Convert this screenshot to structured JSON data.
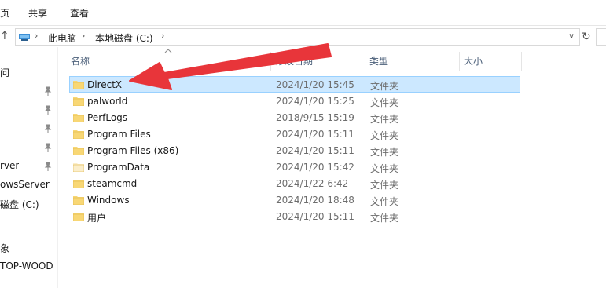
{
  "ribbon": {
    "tabs": [
      "页",
      "共享",
      "查看"
    ]
  },
  "address": {
    "crumbs": [
      "此电脑",
      "本地磁盘 (C:)"
    ],
    "separator": "›"
  },
  "nav": {
    "items": [
      {
        "label": "问",
        "pinned": false
      },
      {
        "label": "",
        "pinned": true
      },
      {
        "label": "",
        "pinned": true
      },
      {
        "label": "",
        "pinned": true
      },
      {
        "label": "",
        "pinned": true
      },
      {
        "label": "rver",
        "pinned": true
      },
      {
        "label": "owsServer",
        "pinned": false
      },
      {
        "label": "磁盘 (C:)",
        "pinned": false
      },
      {
        "label": "",
        "pinned": false
      },
      {
        "label": "象",
        "pinned": false
      },
      {
        "label": "TOP-WOOD",
        "pinned": false
      }
    ]
  },
  "columns": {
    "name": "名称",
    "modified": "修改日期",
    "type": "类型",
    "size": "大小"
  },
  "files": [
    {
      "name": "DirectX",
      "modified": "2024/1/20 15:45",
      "type": "文件夹",
      "selected": true,
      "faded": false
    },
    {
      "name": "palworld",
      "modified": "2024/1/20 15:25",
      "type": "文件夹",
      "selected": false,
      "faded": false
    },
    {
      "name": "PerfLogs",
      "modified": "2018/9/15 15:19",
      "type": "文件夹",
      "selected": false,
      "faded": false
    },
    {
      "name": "Program Files",
      "modified": "2024/1/20 15:11",
      "type": "文件夹",
      "selected": false,
      "faded": false
    },
    {
      "name": "Program Files (x86)",
      "modified": "2024/1/20 15:11",
      "type": "文件夹",
      "selected": false,
      "faded": false
    },
    {
      "name": "ProgramData",
      "modified": "2024/1/20 15:42",
      "type": "文件夹",
      "selected": false,
      "faded": true
    },
    {
      "name": "steamcmd",
      "modified": "2024/1/22 6:42",
      "type": "文件夹",
      "selected": false,
      "faded": false
    },
    {
      "name": "Windows",
      "modified": "2024/1/20 18:48",
      "type": "文件夹",
      "selected": false,
      "faded": false
    },
    {
      "name": "用户",
      "modified": "2024/1/20 15:11",
      "type": "文件夹",
      "selected": false,
      "faded": false
    }
  ],
  "colors": {
    "selection_bg": "#cce8ff",
    "selection_border": "#99d1ff",
    "folder": "#f8d775",
    "folder_faded": "#fbeecb",
    "annotation_arrow": "#e8353a"
  }
}
